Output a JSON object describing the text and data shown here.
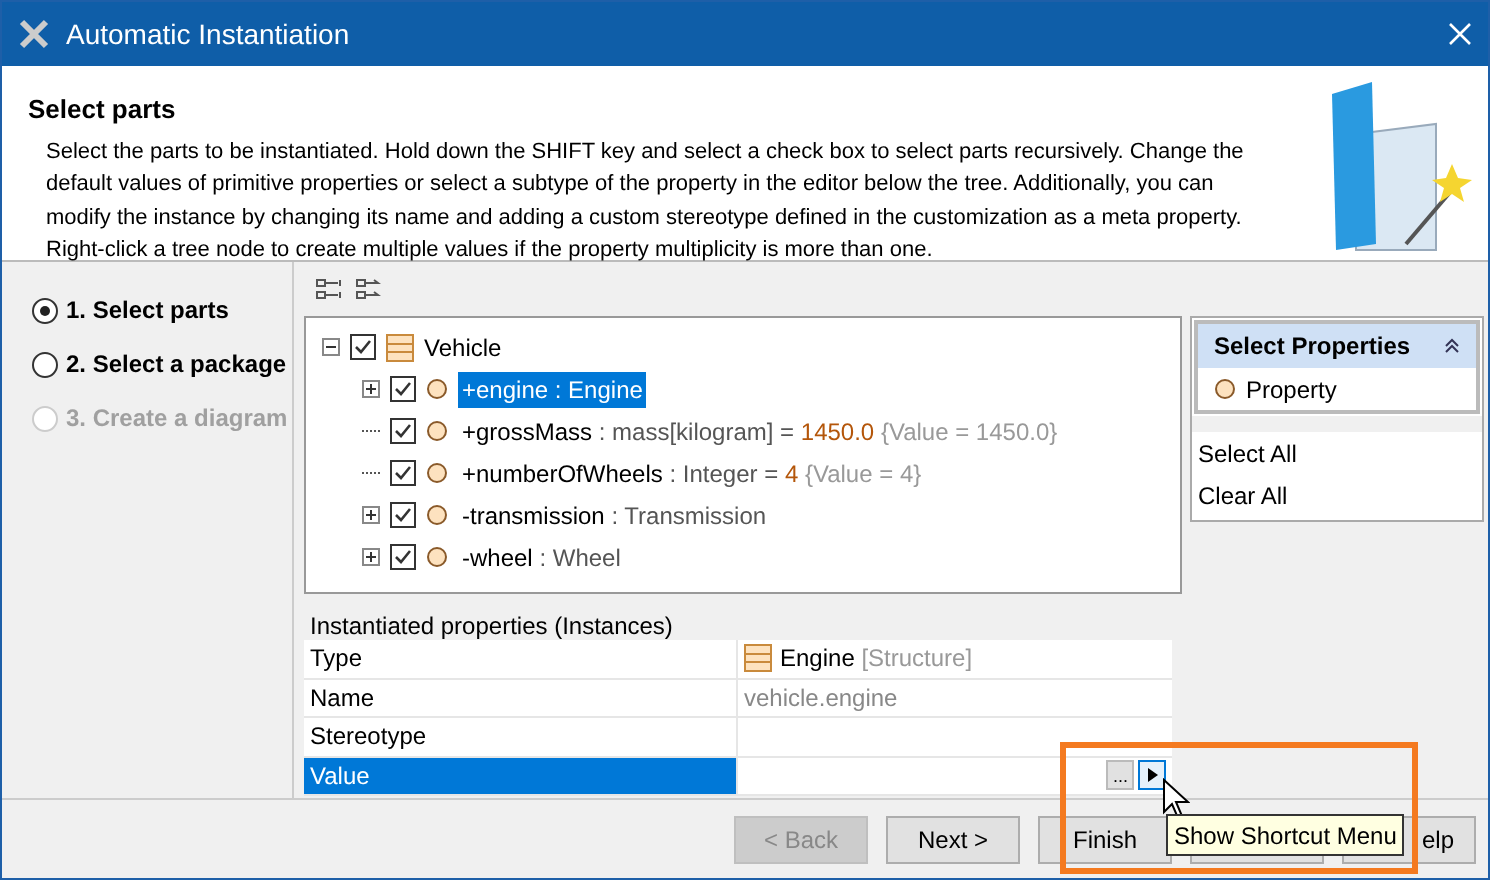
{
  "window": {
    "title": "Automatic Instantiation"
  },
  "header": {
    "title": "Select parts",
    "description": "Select the parts to be instantiated. Hold down the SHIFT key and select a check box to select parts recursively. Change the default values of primitive properties or select a subtype of the property in the editor below the tree. Additionally, you can modify the instance by changing its name and adding a custom stereotype defined in the customization as a meta property. Right-click a tree node to create multiple values if the property multiplicity is more than one."
  },
  "steps": [
    {
      "label": "1. Select parts",
      "selected": true,
      "disabled": false
    },
    {
      "label": "2. Select a package",
      "selected": false,
      "disabled": false
    },
    {
      "label": "3. Create a diagram",
      "selected": false,
      "disabled": true
    }
  ],
  "tree": {
    "label": "Vehicle",
    "checked": true,
    "expanded": true,
    "children": [
      {
        "name": "+engine",
        "type": " : Engine",
        "checked": true,
        "selected": true,
        "expandable": true
      },
      {
        "name": "+grossMass",
        "type": " : mass[kilogram] = ",
        "default": "1450.0",
        "value": " {Value = 1450.0}",
        "checked": true,
        "selected": false,
        "expandable": false
      },
      {
        "name": "+numberOfWheels",
        "type": " : Integer = ",
        "default": "4",
        "value": " {Value = 4}",
        "checked": true,
        "selected": false,
        "expandable": false
      },
      {
        "name": "-transmission",
        "type": " : Transmission",
        "checked": true,
        "selected": false,
        "expandable": true
      },
      {
        "name": "-wheel",
        "type": " : Wheel",
        "checked": true,
        "selected": false,
        "expandable": true
      }
    ]
  },
  "select_properties": {
    "title": "Select Properties",
    "items": [
      "Property"
    ],
    "actions": [
      "Select All",
      "Clear All"
    ]
  },
  "instances": {
    "title": "Instantiated properties (Instances)",
    "rows": [
      {
        "kind": "type",
        "label": "Type",
        "value": "Engine",
        "note": " [Structure]",
        "selected": false
      },
      {
        "kind": "text",
        "label": "Name",
        "value": "vehicle.engine",
        "selected": false
      },
      {
        "kind": "text",
        "label": "Stereotype",
        "selected": false
      },
      {
        "kind": "editor",
        "label": "Value",
        "button": "...",
        "selected": true
      }
    ]
  },
  "buttons": [
    {
      "label": "< Back",
      "disabled": true
    },
    {
      "label": "Next >",
      "disabled": false
    },
    {
      "label": "Finish",
      "disabled": false
    },
    {
      "disabled": false
    },
    {
      "label": "elp",
      "disabled": false
    }
  ],
  "tooltip": "Show Shortcut Menu"
}
